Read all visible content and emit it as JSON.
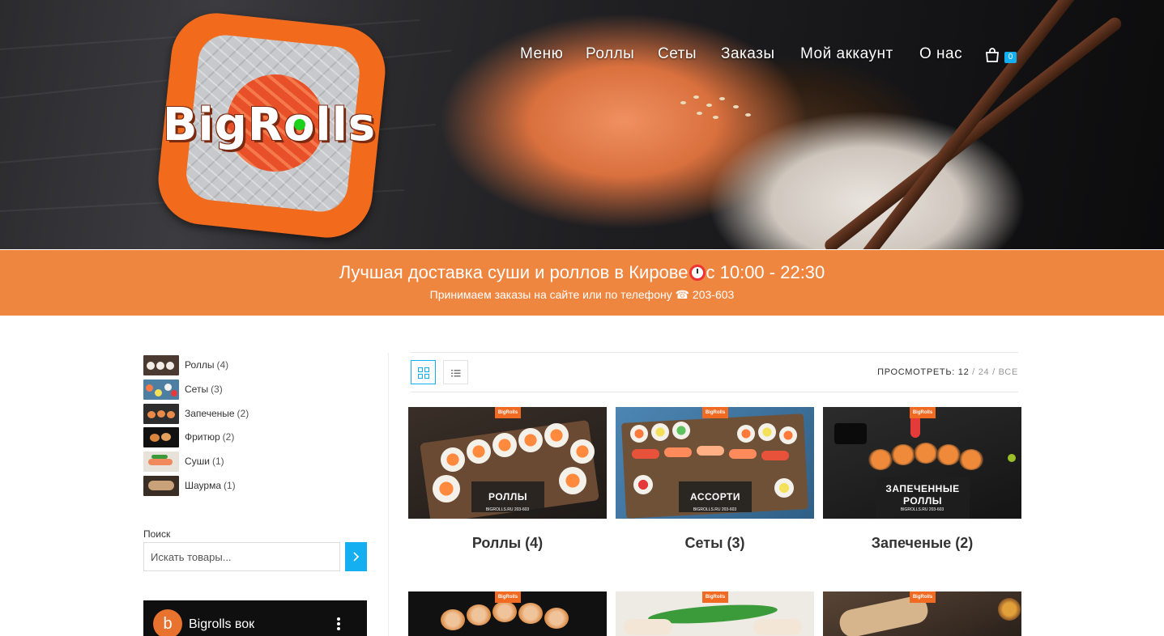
{
  "logo": {
    "text": "BigRolls"
  },
  "nav": {
    "items": [
      "Меню",
      "Роллы",
      "Сеты",
      "Заказы",
      "Мой аккаунт",
      "О нас"
    ],
    "cart_count": "0"
  },
  "banner": {
    "title_before": "Лучшая доставка суши и роллов в Кирове",
    "title_after": "с 10:00 - 22:30",
    "subtitle": "Принимаем заказы на сайте или по телефону ☎ 203-603"
  },
  "sidebar": {
    "categories": [
      {
        "name": "Роллы",
        "count": "(4)"
      },
      {
        "name": "Сеты",
        "count": "(3)"
      },
      {
        "name": "Запеченые",
        "count": "(2)"
      },
      {
        "name": "Фритюр",
        "count": "(2)"
      },
      {
        "name": "Суши",
        "count": "(1)"
      },
      {
        "name": "Шаурма",
        "count": "(1)"
      }
    ],
    "search_label": "Поиск",
    "search_placeholder": "Искать товары...",
    "video": {
      "avatar_letter": "b",
      "title": "Bigrolls вок"
    }
  },
  "toolbar": {
    "view_label": "ПРОСМОТРЕТЬ:",
    "options": [
      "12",
      "24",
      "ВСЕ"
    ],
    "separator": "/"
  },
  "products": [
    {
      "title": "Роллы (4)",
      "badge": "BigRolls",
      "label": "РОЛЛЫ",
      "site": "BIGROLLS.RU 203-603"
    },
    {
      "title": "Сеты (3)",
      "badge": "BigRolls",
      "label": "АССОРТИ",
      "site": "BIGROLLS.RU 203-603"
    },
    {
      "title": "Запеченые (2)",
      "badge": "BigRolls",
      "label": "ЗАПЕЧЕННЫЕ РОЛЛЫ",
      "site": "BIGROLLS.RU 203-603"
    },
    {
      "badge": "BigRolls"
    },
    {
      "badge": "BigRolls"
    },
    {
      "badge": "BigRolls"
    }
  ],
  "colors": {
    "accent": "#13aff0",
    "banner": "#ef8640",
    "logo_orange": "#f26b1d"
  }
}
